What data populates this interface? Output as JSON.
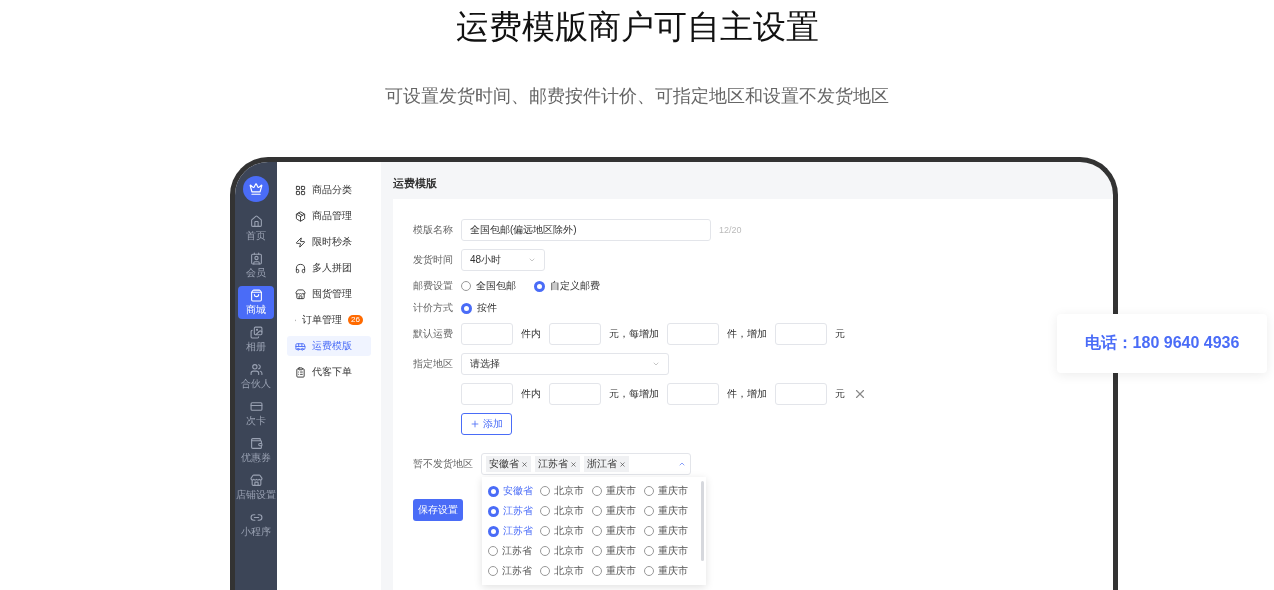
{
  "heading": {
    "title": "运费模版商户可自主设置",
    "subtitle": "可设置发货时间、邮费按件计价、可指定地区和设置不发货地区"
  },
  "rail": {
    "items": [
      {
        "label": "首页",
        "selected": false
      },
      {
        "label": "会员",
        "selected": false
      },
      {
        "label": "商城",
        "selected": true
      },
      {
        "label": "相册",
        "selected": false
      },
      {
        "label": "合伙人",
        "selected": false
      },
      {
        "label": "次卡",
        "selected": false
      },
      {
        "label": "优惠券",
        "selected": false
      },
      {
        "label": "店铺设置",
        "selected": false
      },
      {
        "label": "小程序",
        "selected": false
      }
    ]
  },
  "menu": {
    "items": [
      {
        "label": "商品分类",
        "selected": false
      },
      {
        "label": "商品管理",
        "selected": false
      },
      {
        "label": "限时秒杀",
        "selected": false
      },
      {
        "label": "多人拼团",
        "selected": false
      },
      {
        "label": "囤货管理",
        "selected": false
      },
      {
        "label": "订单管理",
        "selected": false,
        "badge": "26"
      },
      {
        "label": "运费模版",
        "selected": true
      },
      {
        "label": "代客下单",
        "selected": false
      }
    ]
  },
  "page_title": "运费模版",
  "form": {
    "name": {
      "label": "模版名称",
      "value": "全国包邮(偏远地区除外)",
      "count": "12/20"
    },
    "ship_time": {
      "label": "发货时间",
      "value": "48小时"
    },
    "postage": {
      "label": "邮费设置",
      "options": [
        {
          "label": "全国包邮",
          "selected": false
        },
        {
          "label": "自定义邮费",
          "selected": true
        }
      ]
    },
    "pricing": {
      "label": "计价方式",
      "options": [
        {
          "label": "按件",
          "selected": true
        }
      ]
    },
    "default_fee": {
      "label": "默认运费",
      "units": [
        "件内",
        "元，每增加",
        "件，增加",
        "元"
      ]
    },
    "area": {
      "label": "指定地区",
      "placeholder": "请选择",
      "units": [
        "件内",
        "元，每增加",
        "件，增加",
        "元"
      ],
      "add_button": "添加"
    },
    "exclude": {
      "label": "暂不发货地区",
      "tags": [
        "安徽省",
        "江苏省",
        "浙江省"
      ],
      "options": [
        {
          "label": "安徽省",
          "selected": true
        },
        {
          "label": "北京市",
          "selected": false
        },
        {
          "label": "重庆市",
          "selected": false
        },
        {
          "label": "重庆市",
          "selected": false
        },
        {
          "label": "江苏省",
          "selected": true
        },
        {
          "label": "北京市",
          "selected": false
        },
        {
          "label": "重庆市",
          "selected": false
        },
        {
          "label": "重庆市",
          "selected": false
        },
        {
          "label": "江苏省",
          "selected": true
        },
        {
          "label": "北京市",
          "selected": false
        },
        {
          "label": "重庆市",
          "selected": false
        },
        {
          "label": "重庆市",
          "selected": false
        },
        {
          "label": "江苏省",
          "selected": false
        },
        {
          "label": "北京市",
          "selected": false
        },
        {
          "label": "重庆市",
          "selected": false
        },
        {
          "label": "重庆市",
          "selected": false
        },
        {
          "label": "江苏省",
          "selected": false
        },
        {
          "label": "北京市",
          "selected": false
        },
        {
          "label": "重庆市",
          "selected": false
        },
        {
          "label": "重庆市",
          "selected": false
        }
      ]
    },
    "save_button": "保存设置"
  },
  "contact": "电话：180 9640 4936"
}
